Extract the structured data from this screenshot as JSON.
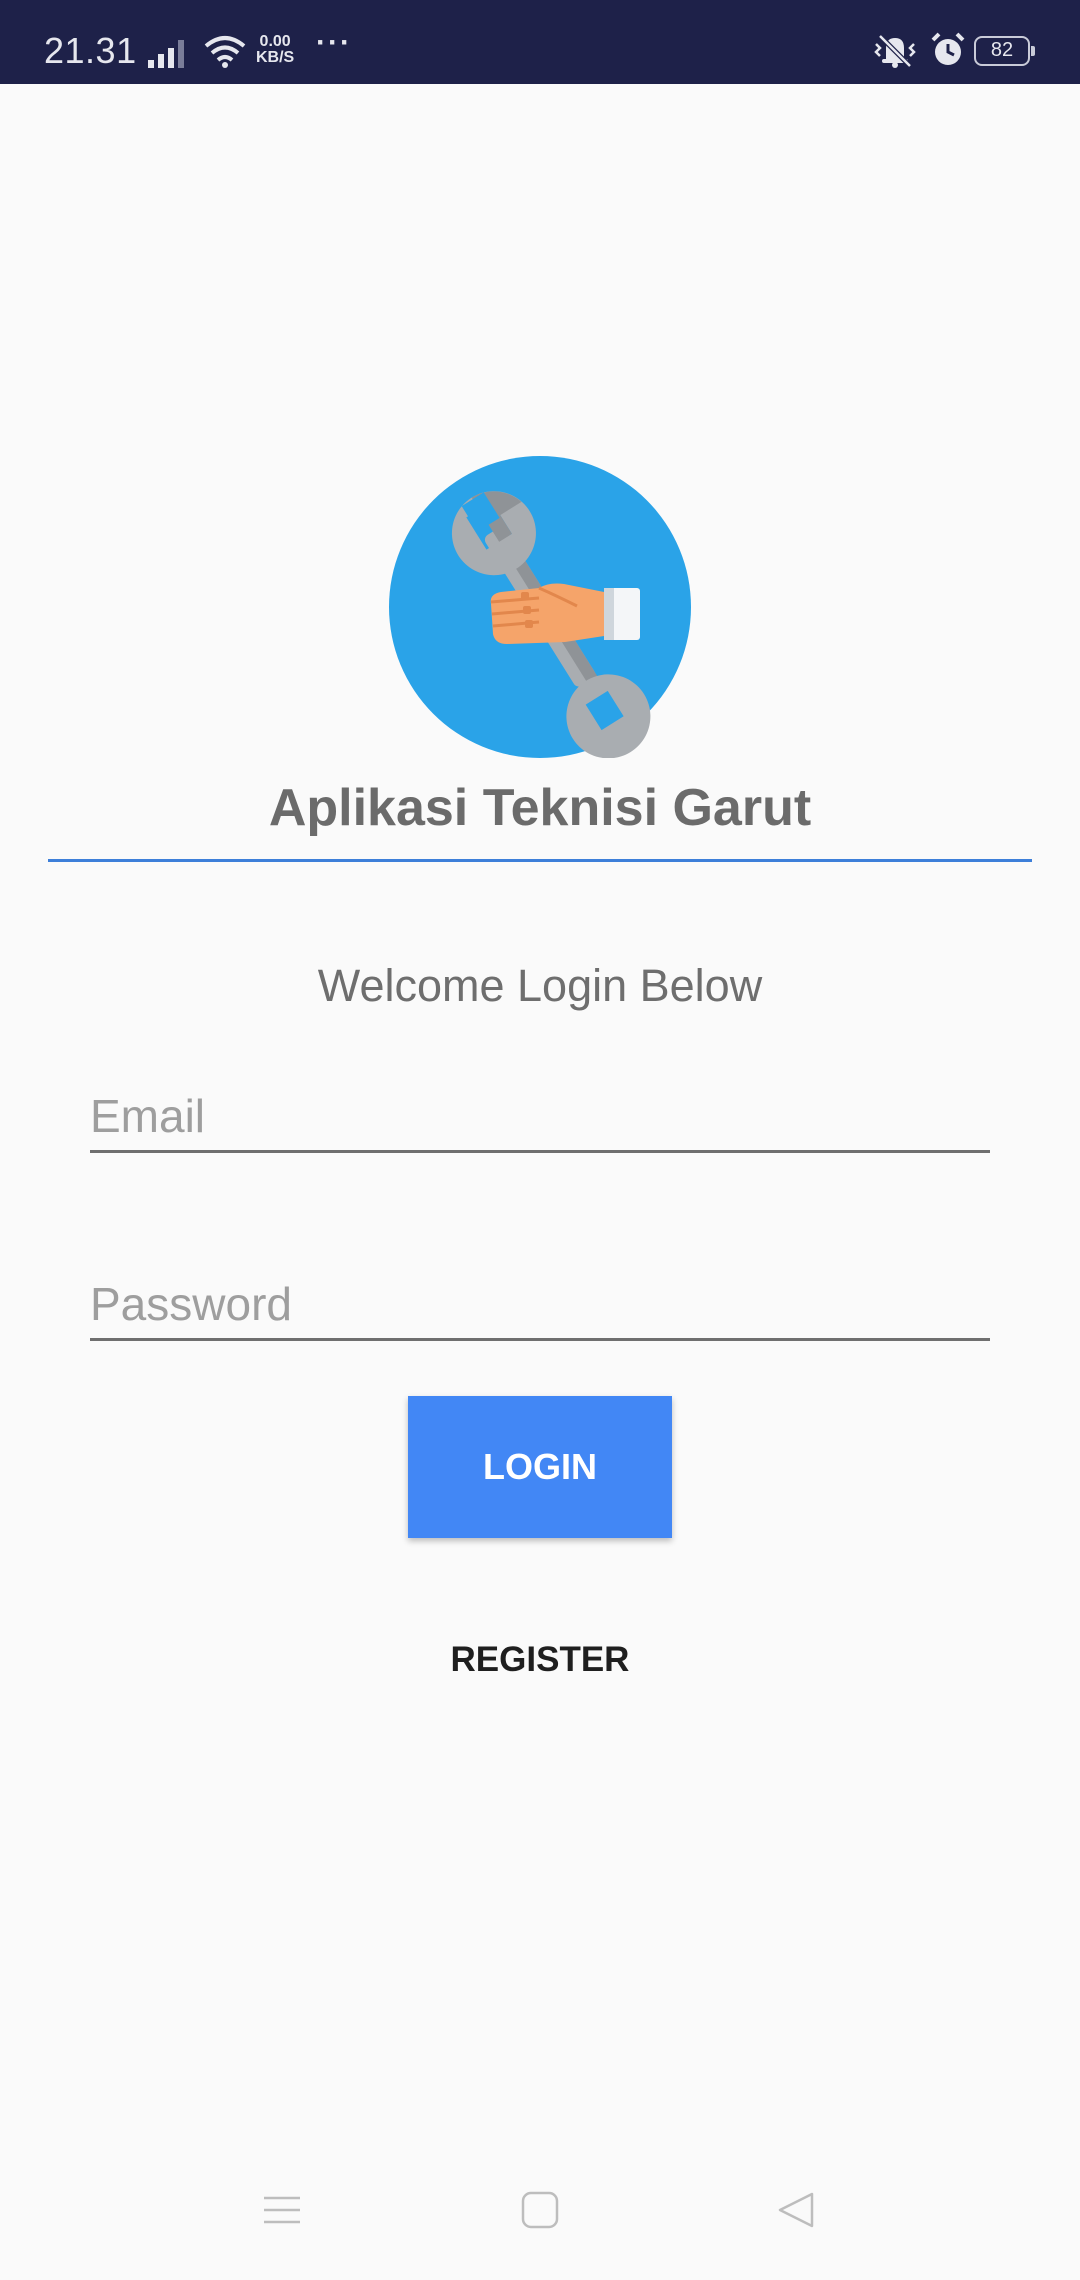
{
  "status_bar": {
    "time": "21.31",
    "speed_value": "0.00",
    "speed_unit": "KB/S",
    "dots": "···",
    "battery": "82",
    "icons": [
      "signal-icon",
      "wifi-icon",
      "vibrate-icon",
      "alarm-icon",
      "battery-icon"
    ]
  },
  "app": {
    "title": "Aplikasi Teknisi Garut",
    "logo_icon": "wrench-hand-logo",
    "accent_color": "#3d7fd9"
  },
  "login": {
    "welcome": "Welcome Login Below",
    "email_placeholder": "Email",
    "password_placeholder": "Password",
    "login_label": "LOGIN",
    "register_label": "REGISTER",
    "button_color": "#4287f5"
  },
  "nav_bar": {
    "icons": [
      "menu-icon",
      "home-icon",
      "back-icon"
    ]
  }
}
